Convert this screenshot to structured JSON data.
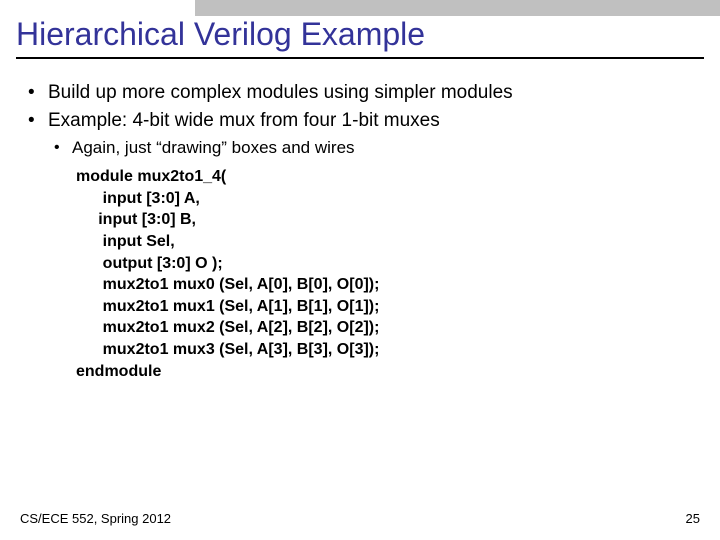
{
  "title": "Hierarchical Verilog Example",
  "bullets": {
    "b1a": "Build up more complex modules using simpler modules",
    "b1b": "Example: 4-bit wide mux from four 1-bit muxes",
    "b2a": "Again, just “drawing” boxes and wires"
  },
  "code": {
    "l1": "module mux2to1_4(",
    "l2": "      input [3:0] A,",
    "l3": "     input [3:0] B,",
    "l4": "      input Sel,",
    "l5": "      output [3:0] O );",
    "l6": "",
    "l7": "      mux2to1 mux0 (Sel, A[0], B[0], O[0]);",
    "l8": "      mux2to1 mux1 (Sel, A[1], B[1], O[1]);",
    "l9": "      mux2to1 mux2 (Sel, A[2], B[2], O[2]);",
    "l10": "      mux2to1 mux3 (Sel, A[3], B[3], O[3]);",
    "l11": "endmodule"
  },
  "footer": {
    "course": "CS/ECE 552, Spring 2012",
    "page": "25"
  }
}
